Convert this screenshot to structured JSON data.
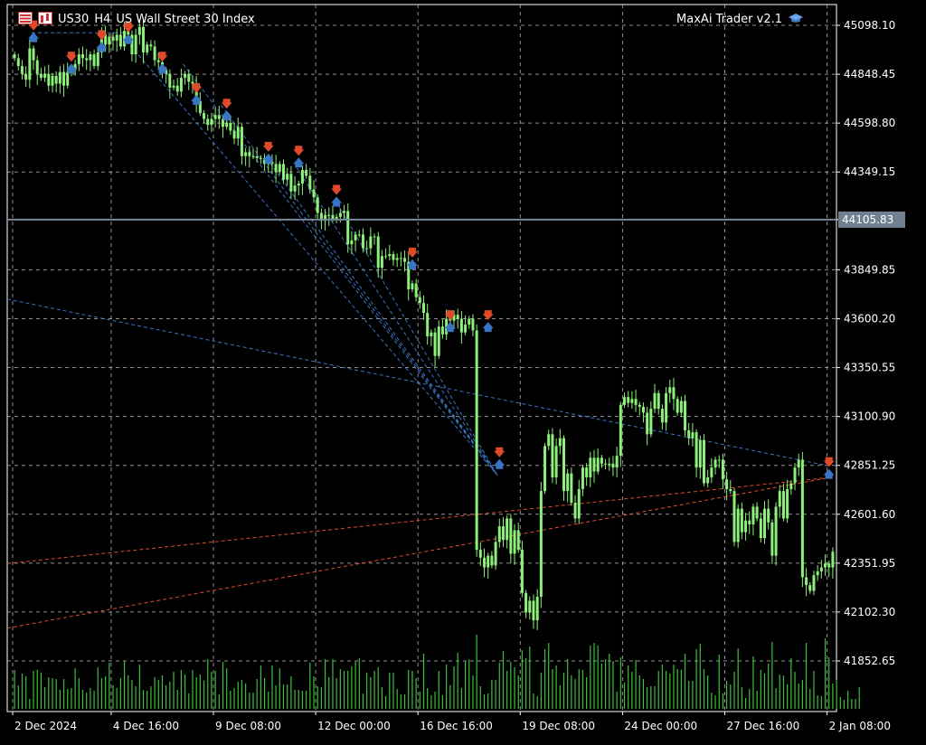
{
  "header": {
    "symbol": "US30",
    "timeframe": "H4",
    "description": "US Wall Street 30 Index",
    "ea_name": "MaxAi Trader v2.1",
    "menu_icon": "terminal-menu-icon",
    "chart_icon": "chart-type-icon",
    "ea_icon": "graduation-cap-icon"
  },
  "colors": {
    "background": "#000000",
    "grid": "#c0c0c0",
    "bull": "#8cf07a",
    "bear": "#8cf07a",
    "volume": "#3dbf3d",
    "current_price_line": "#778899",
    "current_price_label_bg": "#708090",
    "trade_line_blue": "#3a75c4",
    "trade_line_red": "#e04a2a",
    "arrow_sell": "#e04a2a",
    "arrow_buy": "#3a75c4"
  },
  "chart_data": {
    "type": "candlestick",
    "title": "US30,H4 US Wall Street 30 Index",
    "y_ticks": [
      "45098.10",
      "44848.45",
      "44598.80",
      "44349.15",
      "44105.83",
      "43849.85",
      "43600.20",
      "43350.55",
      "43100.90",
      "42851.25",
      "42601.60",
      "42351.95",
      "42102.30",
      "41852.65"
    ],
    "y_tick_values": [
      45098.1,
      44848.45,
      44598.8,
      44349.15,
      44105.83,
      43849.85,
      43600.2,
      43350.55,
      43100.9,
      42851.25,
      42601.6,
      42351.95,
      42102.3,
      41852.65
    ],
    "x_ticks": [
      "2 Dec 2024",
      "4 Dec 16:00",
      "9 Dec 08:00",
      "12 Dec 00:00",
      "16 Dec 16:00",
      "19 Dec 08:00",
      "24 Dec 00:00",
      "27 Dec 16:00",
      "2 Jan 08:00"
    ],
    "x_tick_bar_index": [
      0,
      26,
      53,
      80,
      107,
      134,
      161,
      188,
      215
    ],
    "current_price": 44105.83,
    "current_price_label": "44105.83",
    "grid": true,
    "close": [
      44930,
      44890,
      44850,
      44820,
      44980,
      44920,
      44850,
      44830,
      44850,
      44790,
      44840,
      44800,
      44860,
      44790,
      44860,
      44870,
      44900,
      44950,
      44930,
      44920,
      44950,
      44890,
      44960,
      45050,
      45000,
      45040,
      45020,
      45050,
      44990,
      45070,
      45050,
      44950,
      45050,
      45090,
      44960,
      45000,
      44990,
      44920,
      44910,
      44870,
      44850,
      44780,
      44790,
      44760,
      44830,
      44850,
      44810,
      44800,
      44710,
      44650,
      44620,
      44590,
      44620,
      44640,
      44620,
      44580,
      44600,
      44560,
      44520,
      44580,
      44430,
      44450,
      44430,
      44430,
      44420,
      44420,
      44390,
      44400,
      44390,
      44350,
      44390,
      44310,
      44340,
      44250,
      44280,
      44290,
      44360,
      44330,
      44260,
      44220,
      44140,
      44100,
      44130,
      44130,
      44110,
      44120,
      44140,
      44150,
      43980,
      44000,
      44030,
      44030,
      43960,
      43960,
      44020,
      44020,
      43860,
      43920,
      43920,
      43930,
      43900,
      43910,
      43910,
      43890,
      43750,
      43780,
      43710,
      43680,
      43630,
      43510,
      43530,
      43410,
      43560,
      43520,
      43600,
      43590,
      43620,
      43600,
      43530,
      43570,
      43600,
      43540,
      42420,
      42380,
      42330,
      42390,
      42340,
      42460,
      42540,
      42470,
      42580,
      42400,
      42520,
      42420,
      42200,
      42100,
      42160,
      42060,
      42180,
      42720,
      42950,
      43010,
      42790,
      42950,
      42990,
      42720,
      42810,
      42660,
      42580,
      42730,
      42840,
      42790,
      42890,
      42820,
      42890,
      42860,
      42860,
      42860,
      42840,
      42900,
      43160,
      43200,
      43170,
      43190,
      43160,
      43150,
      43120,
      43010,
      43140,
      43220,
      43140,
      43070,
      43220,
      43250,
      43190,
      43120,
      43180,
      43030,
      42990,
      43020,
      42840,
      42980,
      42760,
      42790,
      42840,
      42880,
      42880,
      42780,
      42730,
      42720,
      42460,
      42630,
      42510,
      42570,
      42550,
      42640,
      42580,
      42480,
      42630,
      42560,
      42390,
      42640,
      42720,
      42580,
      42730,
      42760,
      42840,
      42880,
      42280,
      42240,
      42210,
      42290,
      42310,
      42330,
      42350,
      42330,
      42410
    ],
    "volume": [
      43,
      26,
      39,
      36,
      11,
      42,
      43,
      40,
      24,
      35,
      34,
      33,
      21,
      33,
      22,
      23,
      45,
      34,
      21,
      18,
      23,
      20,
      46,
      34,
      36,
      51,
      26,
      23,
      34,
      53,
      37,
      32,
      25,
      49,
      21,
      20,
      25,
      35,
      32,
      37,
      26,
      30,
      41,
      21,
      43,
      38,
      17,
      43,
      35,
      38,
      31,
      55,
      41,
      42,
      16,
      52,
      45,
      20,
      23,
      30,
      32,
      28,
      18,
      18,
      33,
      48,
      34,
      19,
      48,
      26,
      45,
      27,
      27,
      36,
      21,
      21,
      20,
      20,
      51,
      36,
      25,
      24,
      55,
      35,
      55,
      34,
      44,
      42,
      42,
      47,
      52,
      56,
      17,
      40,
      35,
      42,
      46,
      24,
      14,
      40,
      40,
      22,
      16,
      16,
      43,
      42,
      34,
      19,
      61,
      23,
      15,
      19,
      42,
      15,
      49,
      26,
      47,
      62,
      23,
      53,
      55,
      37,
      82,
      25,
      16,
      17,
      32,
      32,
      51,
      64,
      42,
      52,
      46,
      37,
      65,
      56,
      69,
      17,
      14,
      40,
      66,
      73,
      44,
      48,
      26,
      40,
      55,
      37,
      33,
      44,
      43,
      35,
      70,
      73,
      70,
      50,
      55,
      61,
      53,
      19,
      57,
      29,
      48,
      41,
      54,
      37,
      33,
      24,
      25,
      25,
      42,
      49,
      42,
      39,
      49,
      44,
      43,
      61,
      31,
      31,
      66,
      72,
      44,
      37,
      18,
      15,
      60,
      17,
      31,
      27,
      41,
      67,
      24,
      12,
      22,
      58,
      20,
      43,
      39,
      50,
      74,
      23,
      38,
      37,
      27,
      56,
      41,
      28,
      32,
      73,
      22,
      42,
      15,
      14,
      78,
      57,
      28,
      32,
      13,
      10,
      20,
      11,
      11,
      24
    ]
  }
}
